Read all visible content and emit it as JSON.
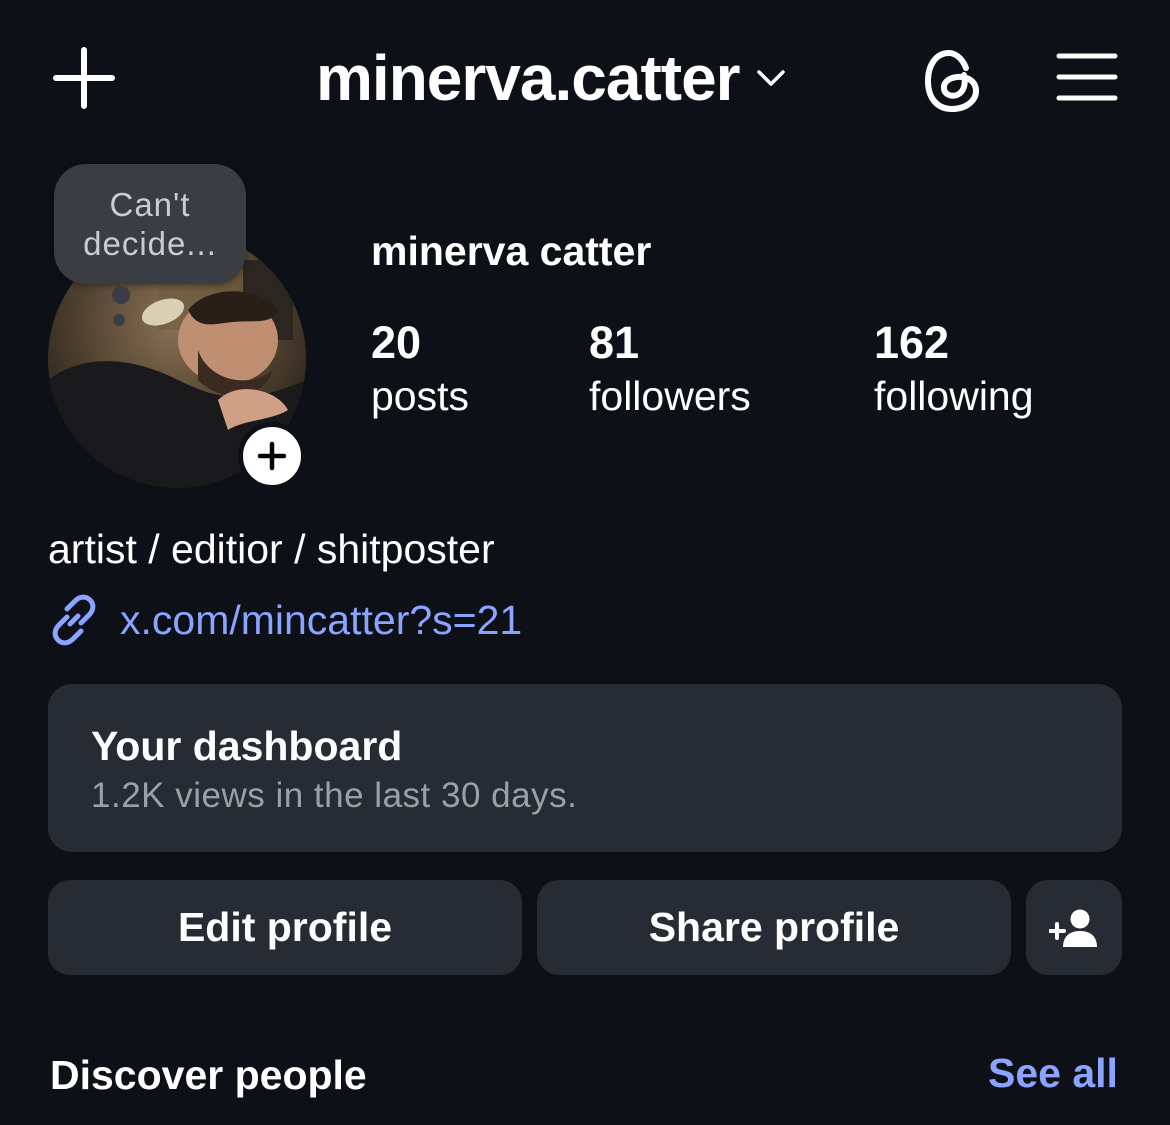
{
  "header": {
    "username": "minerva.catter",
    "icons": {
      "new_post": "plus-icon",
      "account_switch": "chevron-down-icon",
      "threads": "threads-icon",
      "menu": "hamburger-menu-icon"
    }
  },
  "profile": {
    "note": {
      "line1": "Can't",
      "line2": "decide..."
    },
    "full_name": "minerva catter",
    "stats": [
      {
        "value": "20",
        "label": "posts"
      },
      {
        "value": "81",
        "label": "followers"
      },
      {
        "value": "162",
        "label": "following"
      }
    ],
    "bio": "artist / editior / shitposter",
    "link": "x.com/mincatter?s=21"
  },
  "dashboard": {
    "title": "Your dashboard",
    "subtitle": "1.2K views in the last 30 days."
  },
  "actions": {
    "edit": "Edit profile",
    "share": "Share profile",
    "discover_icon": "add-person-icon"
  },
  "discover": {
    "title": "Discover people",
    "see_all": "See all"
  },
  "colors": {
    "background": "#0d1017",
    "surface": "#272b33",
    "link": "#8aa4ff",
    "muted": "#9aa0a8"
  }
}
